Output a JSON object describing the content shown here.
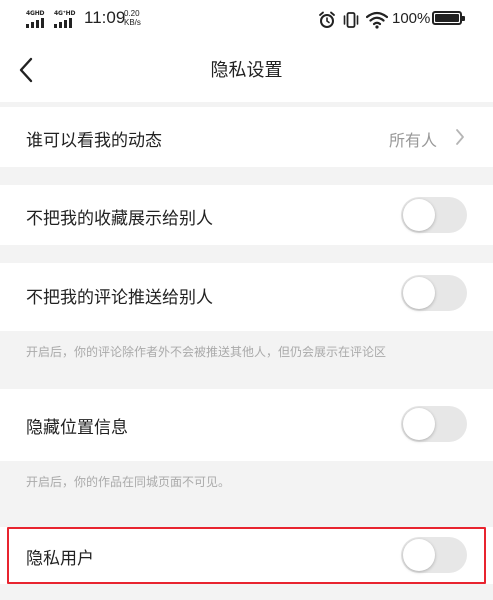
{
  "status_bar": {
    "net_1": "4GHD",
    "net_2": "4G⁺HD",
    "time": "11:09",
    "speed_value": "0.20",
    "speed_unit": "KB/s",
    "battery_pct": "100%",
    "battery_level": 1.0
  },
  "nav": {
    "title": "隐私设置"
  },
  "rows": {
    "who_can_see": {
      "label": "谁可以看我的动态",
      "value": "所有人"
    },
    "hide_favorites": {
      "label": "不把我的收藏展示给别人",
      "on": false
    },
    "hide_comments": {
      "label": "不把我的评论推送给别人",
      "on": false
    },
    "hide_location": {
      "label": "隐藏位置信息",
      "on": false
    },
    "private_user": {
      "label": "隐私用户",
      "on": false
    }
  },
  "notes": {
    "comments_note": "开启后，你的评论除作者外不会被推送其他人，但仍会展示在评论区",
    "location_note": "开启后，你的作品在同城页面不可见。"
  },
  "colors": {
    "background": "#f3f3f3",
    "toggle_off": "#e7e7e7",
    "highlight": "#e8242f",
    "muted_text": "#aaaaaa"
  }
}
